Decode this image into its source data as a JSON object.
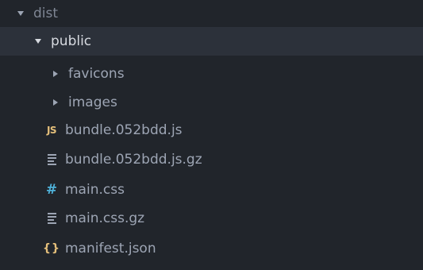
{
  "tree": {
    "root": {
      "label": "dist",
      "expanded": true
    },
    "public": {
      "label": "public",
      "expanded": true,
      "selected": true
    },
    "items": [
      {
        "label": "favicons",
        "kind": "folder",
        "icon": "chevron-right-icon"
      },
      {
        "label": "images",
        "kind": "folder",
        "icon": "chevron-right-icon"
      },
      {
        "label": "bundle.052bdd.js",
        "kind": "file",
        "icon": "js-file-icon",
        "icon_text": "JS",
        "icon_color": "#e5c07b"
      },
      {
        "label": "bundle.052bdd.js.gz",
        "kind": "file",
        "icon": "text-file-icon"
      },
      {
        "label": "main.css",
        "kind": "file",
        "icon": "css-file-icon",
        "icon_text": "#",
        "icon_color": "#4fb1d8"
      },
      {
        "label": "main.css.gz",
        "kind": "file",
        "icon": "text-file-icon"
      },
      {
        "label": "manifest.json",
        "kind": "file",
        "icon": "json-file-icon",
        "icon_text": "{}",
        "icon_color": "#e5c07b"
      }
    ]
  },
  "colors": {
    "background": "#21252b",
    "selected_row": "#2c313a",
    "text": "#9da5b4"
  }
}
